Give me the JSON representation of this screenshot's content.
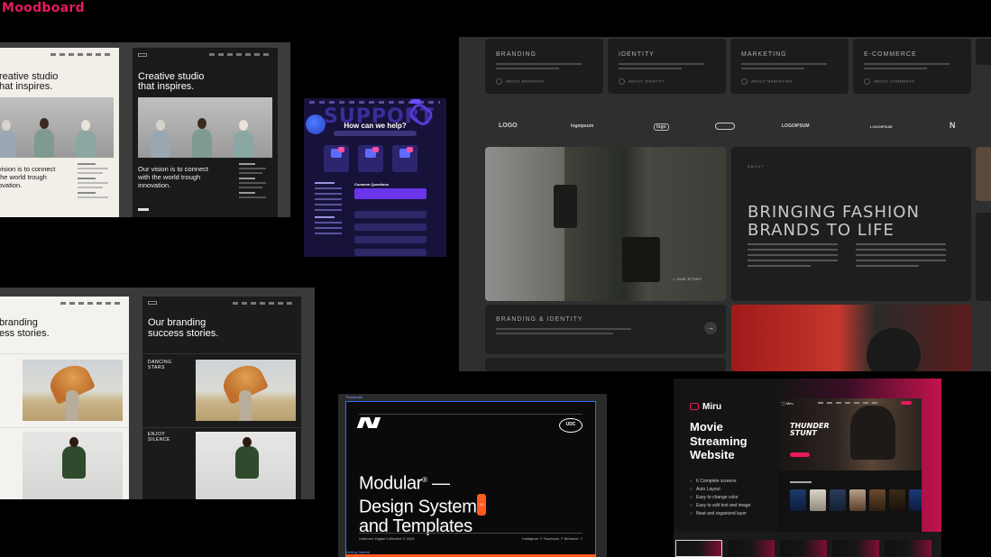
{
  "page": {
    "title": "Moodboard"
  },
  "studio": {
    "heading_line1": "Creative studio",
    "heading_line2": "that inspires.",
    "heading_cut_line1": "reative studio",
    "heading_cut_line2": "hat inspires.",
    "vision_cut_1": "vision is to connect",
    "vision_cut_2": "the world trough",
    "vision_cut_3": "ovation.",
    "vision_1": "Our vision is to connect",
    "vision_2": "with the world trough",
    "vision_3": "innovation."
  },
  "support": {
    "word": "SUPPORT",
    "question": "How can we help?",
    "common_questions": "Common Questions"
  },
  "fashion": {
    "services": [
      {
        "title": "BRANDING",
        "link": "ABOUT BRANDING"
      },
      {
        "title": "IDENTITY",
        "link": "ABOUT IDENTITY"
      },
      {
        "title": "MARKETING",
        "link": "ABOUT MARKETING"
      },
      {
        "title": "E-COMMERCE",
        "link": "ABOUT COMMERCE"
      }
    ],
    "logos": [
      "LOGO",
      "logoipsum",
      "logo",
      "logoipsum",
      "LOGOIPSUM",
      "LOGOIPSUM",
      "N"
    ],
    "about_label": "ABOUT",
    "heading_line1": "BRINGING FASHION",
    "heading_line2": "BRANDS TO LIFE",
    "branding_identity": "BRANDING & IDENTITY"
  },
  "branding": {
    "heading_cut_line1": "branding",
    "heading_cut_line2": "ess stories.",
    "heading_line1": "Our branding",
    "heading_line2": "success stories.",
    "item1_line1": "DANCING",
    "item1_line2": "STARS",
    "item2_line1": "ENJOY",
    "item2_line2": "SILENCE"
  },
  "modular": {
    "caption": "Thumbnail",
    "seal": "UDC",
    "heading_line1": "Modular",
    "heading_line1_suffix": " —",
    "heading_line2": "Design System",
    "heading_line3": "and Templates",
    "badge": "2.0",
    "footer_left": "Unknown Digital Collective © 2024",
    "footer_right": "Instagram ↗   Facebook ↗   Behance ↗",
    "getting_started": "Getting Started"
  },
  "miru": {
    "brand": "Miru",
    "title_line1": "Movie",
    "title_line2": "Streaming",
    "title_line3": "Website",
    "features": [
      "6 Complete screens",
      "Auto Layout",
      "Easy to change color",
      "Easy to edit text and image",
      "Neat and organized layer"
    ],
    "hero_title_line1": "THUNDER",
    "hero_title_line2": "STUNT"
  }
}
